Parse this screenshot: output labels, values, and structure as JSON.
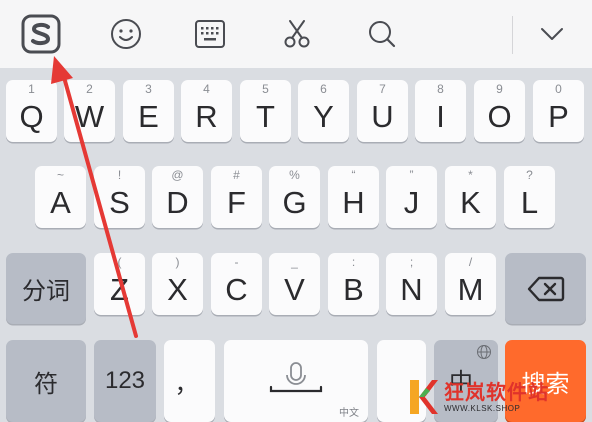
{
  "toolbar": {
    "items": [
      {
        "icon": "sogou-logo-icon"
      },
      {
        "icon": "emoji-icon"
      },
      {
        "icon": "keyboard-icon"
      },
      {
        "icon": "scissors-icon"
      },
      {
        "icon": "search-icon"
      },
      {
        "icon": "chevron-down-icon"
      }
    ]
  },
  "keyboard": {
    "row1": [
      {
        "hint": "1",
        "key": "Q"
      },
      {
        "hint": "2",
        "key": "W"
      },
      {
        "hint": "3",
        "key": "E"
      },
      {
        "hint": "4",
        "key": "R"
      },
      {
        "hint": "5",
        "key": "T"
      },
      {
        "hint": "6",
        "key": "Y"
      },
      {
        "hint": "7",
        "key": "U"
      },
      {
        "hint": "8",
        "key": "I"
      },
      {
        "hint": "9",
        "key": "O"
      },
      {
        "hint": "0",
        "key": "P"
      }
    ],
    "row2": [
      {
        "hint": "~",
        "key": "A"
      },
      {
        "hint": "!",
        "key": "S"
      },
      {
        "hint": "@",
        "key": "D"
      },
      {
        "hint": "#",
        "key": "F"
      },
      {
        "hint": "%",
        "key": "G"
      },
      {
        "hint": "“",
        "key": "H"
      },
      {
        "hint": "”",
        "key": "J"
      },
      {
        "hint": "*",
        "key": "K"
      },
      {
        "hint": "?",
        "key": "L"
      }
    ],
    "row3": [
      {
        "hint": "(",
        "key": "Z"
      },
      {
        "hint": ")",
        "key": "X"
      },
      {
        "hint": "-",
        "key": "C"
      },
      {
        "hint": "_",
        "key": "V"
      },
      {
        "hint": ":",
        "key": "B"
      },
      {
        "hint": ";",
        "key": "N"
      },
      {
        "hint": "/",
        "key": "M"
      }
    ],
    "fenci": "分词",
    "fu": "符",
    "num": "123",
    "comma": "，",
    "space_sub": "中文",
    "lang": "中",
    "search": "搜索"
  },
  "watermark": {
    "title": "狂岚软件站",
    "url": "WWW.KLSK.SHOP"
  },
  "colors": {
    "accent": "#ff6a2c",
    "arrow": "#e53935",
    "brand": "#e0332b"
  }
}
